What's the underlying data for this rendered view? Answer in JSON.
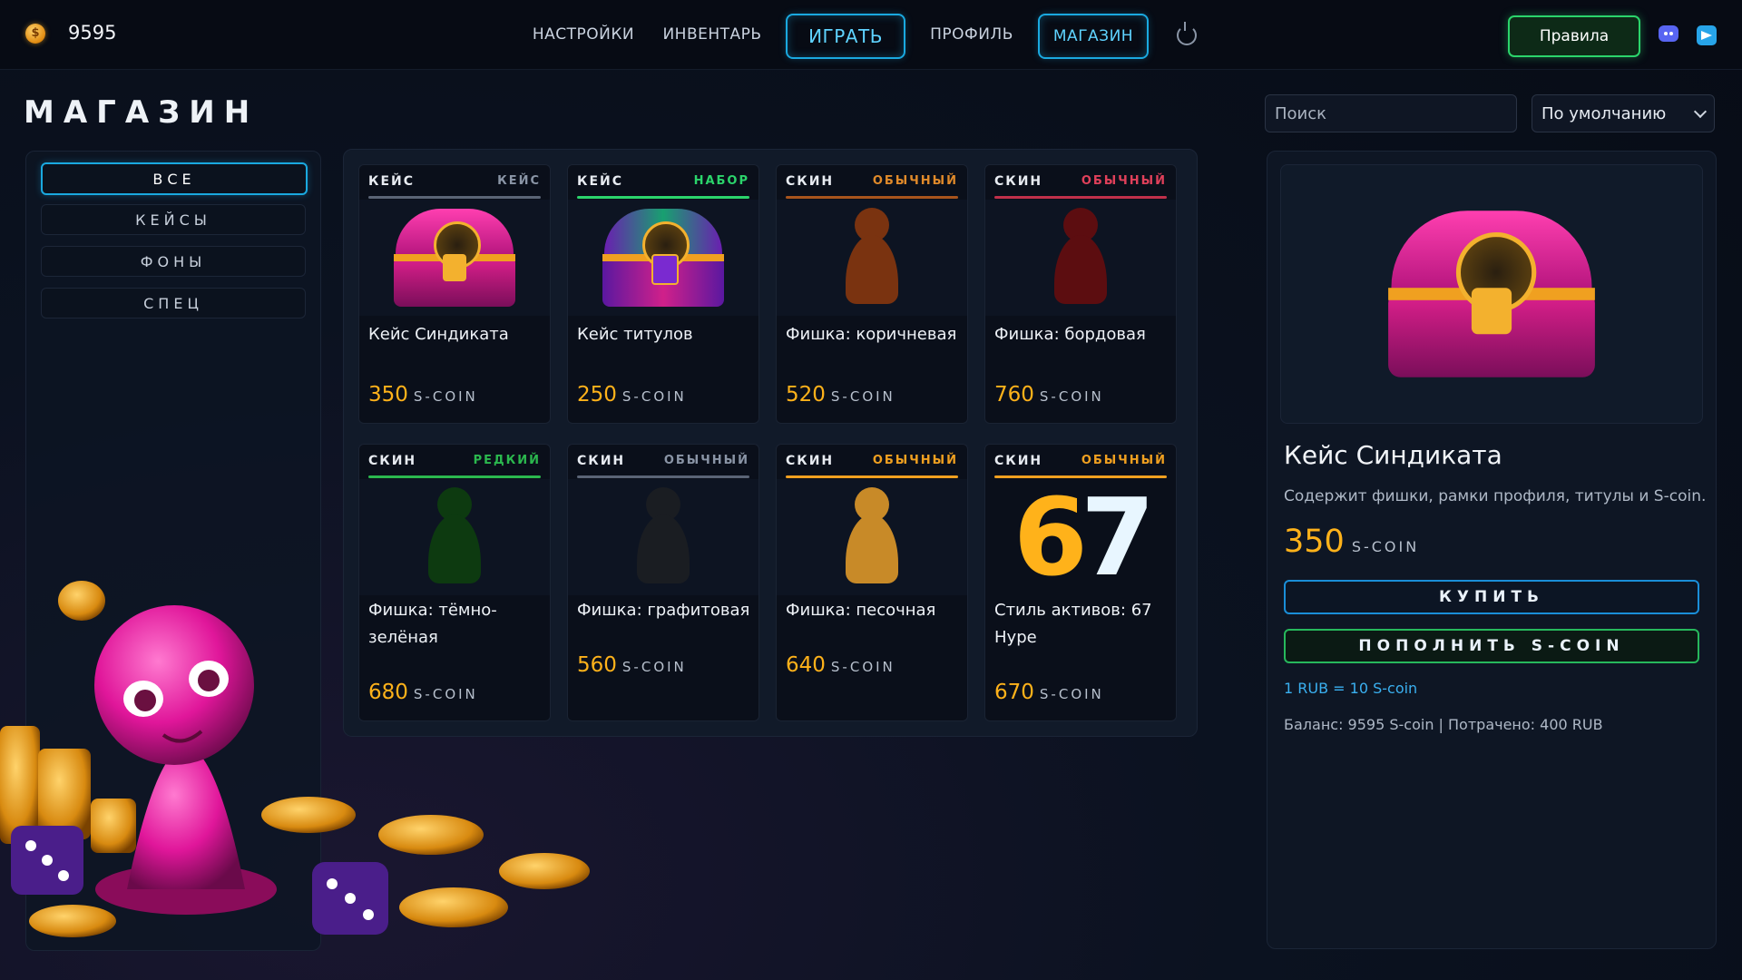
{
  "topbar": {
    "balance": "9595",
    "coin_icon": "s-coin-icon",
    "nav": [
      {
        "label": "НАСТРОЙКИ"
      },
      {
        "label": "ИНВЕНТАРЬ"
      },
      {
        "label": "ИГРАТЬ"
      },
      {
        "label": "ПРОФИЛЬ"
      },
      {
        "label": "МАГАЗИН"
      }
    ],
    "rules_label": "Правила"
  },
  "page": {
    "title": "МАГАЗИН",
    "search_placeholder": "Поиск",
    "sort_value": "По умолчанию"
  },
  "categories": [
    {
      "label": "ВСЕ",
      "active": true
    },
    {
      "label": "КЕЙСЫ"
    },
    {
      "label": "ФОНЫ"
    },
    {
      "label": "СПЕЦ"
    }
  ],
  "currency": "S-COIN",
  "items": [
    {
      "type": "КЕЙС",
      "rarity": "КЕЙС",
      "rarity_color": "#8a95a6",
      "line_color": "#5a6475",
      "name": "Кейс Синдиката",
      "price": "350",
      "image": "chest-pink"
    },
    {
      "type": "КЕЙС",
      "rarity": "НАБОР",
      "rarity_color": "#2bd46b",
      "line_color": "#2bd46b",
      "name": "Кейс титулов",
      "price": "250",
      "image": "chest-multi"
    },
    {
      "type": "СКИН",
      "rarity": "ОБЫЧНЫЙ",
      "rarity_color": "#e08a2a",
      "line_color": "#a8541c",
      "name": "Фишка: коричневая",
      "price": "520",
      "image": "pawn",
      "pawn_color": "#7a3310"
    },
    {
      "type": "СКИН",
      "rarity": "ОБЫЧНЫЙ",
      "rarity_color": "#e0405a",
      "line_color": "#c0304a",
      "name": "Фишка: бордовая",
      "price": "760",
      "image": "pawn",
      "pawn_color": "#5c0d10"
    },
    {
      "type": "СКИН",
      "rarity": "РЕДКИЙ",
      "rarity_color": "#2bb84e",
      "line_color": "#2bb84e",
      "name": "Фишка: тёмно-зелёная",
      "price": "680",
      "image": "pawn",
      "pawn_color": "#0d3a10"
    },
    {
      "type": "СКИН",
      "rarity": "ОБЫЧНЫЙ",
      "rarity_color": "#8a95a6",
      "line_color": "#5a6475",
      "name": "Фишка: графитовая",
      "price": "560",
      "image": "pawn",
      "pawn_color": "#1a1d22"
    },
    {
      "type": "СКИН",
      "rarity": "ОБЫЧНЫЙ",
      "rarity_color": "#f0a020",
      "line_color": "#f0a020",
      "name": "Фишка: песочная",
      "price": "640",
      "image": "pawn",
      "pawn_color": "#c88a28"
    },
    {
      "type": "СКИН",
      "rarity": "ОБЫЧНЫЙ",
      "rarity_color": "#f0a020",
      "line_color": "#f0a020",
      "name": "Стиль активов: 67 Hype",
      "price": "670",
      "image": "sixty-seven"
    }
  ],
  "detail": {
    "title": "Кейс Синдиката",
    "description": "Содержит фишки, рамки профиля, титулы и S-coin.",
    "price": "350",
    "buy_label": "КУПИТЬ",
    "topup_label": "ПОПОЛНИТЬ S-COIN",
    "rate": "1 RUB = 10 S-coin",
    "stats": "Баланс: 9595 S-coin | Потрачено: 400 RUB"
  },
  "colors": {
    "accent_blue": "#1aa9e0",
    "accent_green": "#2bd46b",
    "price_gold": "#ffb21a"
  }
}
